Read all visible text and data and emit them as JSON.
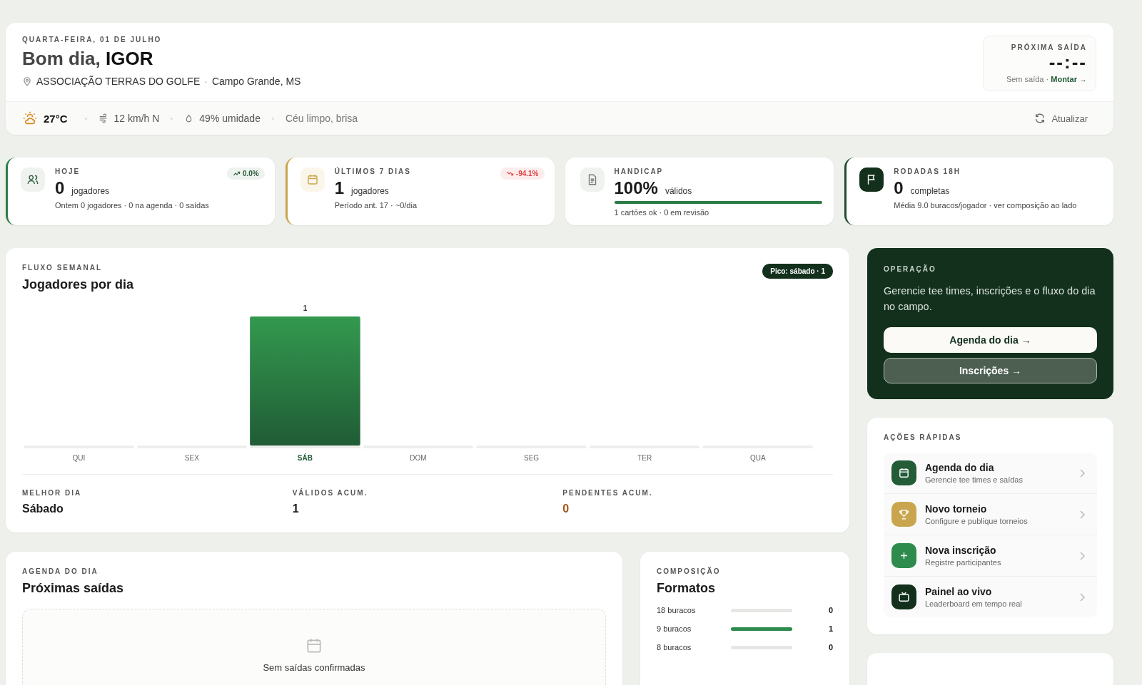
{
  "header": {
    "date": "QUARTA-FEIRA, 01 DE JULHO",
    "greeting": "Bom dia,",
    "name": "IGOR",
    "club": "ASSOCIAÇÃO TERRAS DO GOLFE",
    "separator": "·",
    "city": "Campo Grande, MS",
    "next": {
      "label": "PRÓXIMA SAÍDA",
      "time": "--:--",
      "note": "Sem saída ·",
      "link": "Montar →"
    }
  },
  "weather": {
    "temp": "27°C",
    "wind": "12 km/h N",
    "humidity": "49% umidade",
    "sky": "Céu limpo, brisa",
    "refresh": "Atualizar"
  },
  "stats": [
    {
      "kind": "people",
      "color": "#2e7d46",
      "label": "HOJE",
      "value": "0",
      "unit": "jogadores",
      "note": "Ontem 0 jogadores · 0 na agenda · 0 saídas",
      "trend": {
        "kind": "up",
        "text": "0.0%"
      }
    },
    {
      "kind": "calendar",
      "color": "#c9a64e",
      "label": "ÚLTIMOS 7 DIAS",
      "value": "1",
      "unit": "jogadores",
      "note": "Período ant. 17 · ~0/dia",
      "trend": {
        "kind": "down",
        "text": "-94.1%"
      }
    },
    {
      "kind": "document",
      "label": "HANDICAP",
      "value": "100%",
      "unit": "válidos",
      "note": "1 cartões ok · 0 em revisão",
      "level": 1
    },
    {
      "kind": "flag",
      "color": "#1f4d2e",
      "label": "RODADAS 18H",
      "value": "0",
      "unit": "completas",
      "note": "Média 9.0 buracos/jogador · ver composição ao lado"
    }
  ],
  "weekly": {
    "eyebrow": "FLUXO SEMANAL",
    "title": "Jogadores por dia",
    "peak": "Pico: sábado · 1",
    "chart_data": {
      "type": "bar",
      "categories": [
        "QUI",
        "SEX",
        "SÁB",
        "DOM",
        "SEG",
        "TER",
        "QUA"
      ],
      "values": [
        0,
        0,
        1,
        0,
        0,
        0,
        0
      ],
      "value_labels": [
        null,
        null,
        "1",
        null,
        null,
        null,
        null
      ]
    },
    "summary": [
      {
        "label": "MELHOR DIA",
        "value": "Sábado",
        "kind": "normal"
      },
      {
        "label": "VÁLIDOS ACUM.",
        "value": "1",
        "kind": "normal"
      },
      {
        "label": "PENDENTES ACUM.",
        "value": "0",
        "kind": "warning"
      }
    ]
  },
  "operation": {
    "eyebrow": "OPERAÇÃO",
    "text": "Gerencie tee times, inscrições e o fluxo do dia no campo.",
    "buttons": [
      {
        "label": "Agenda do dia →",
        "kind": "primary"
      },
      {
        "label": "Inscrições →",
        "kind": "secondary"
      }
    ]
  },
  "quick_actions": {
    "title": "AÇÕES RÁPIDAS",
    "items": [
      {
        "kind": "calendar",
        "color": "#245c38",
        "title": "Agenda do dia",
        "subtitle": "Gerencie tee times e saídas"
      },
      {
        "kind": "trophy",
        "color": "#c9a64e",
        "title": "Novo torneio",
        "subtitle": "Configure e publique torneios"
      },
      {
        "kind": "plus",
        "color": "#2e8b4e",
        "title": "Nova inscrição",
        "subtitle": "Registre participantes"
      },
      {
        "kind": "tv",
        "color": "#13301d",
        "title": "Painel ao vivo",
        "subtitle": "Leaderboard em tempo real"
      }
    ]
  },
  "agenda": {
    "eyebrow": "AGENDA DO DIA",
    "title": "Próximas saídas",
    "empty": "Sem saídas confirmadas"
  },
  "composition": {
    "eyebrow": "COMPOSIÇÃO",
    "title": "Formatos",
    "rows": [
      {
        "label": "18 buracos",
        "level": 0,
        "count": "0"
      },
      {
        "label": "9 buracos",
        "level": 1,
        "count": "1"
      },
      {
        "label": "8 buracos",
        "level": 0,
        "count": "0"
      }
    ]
  }
}
